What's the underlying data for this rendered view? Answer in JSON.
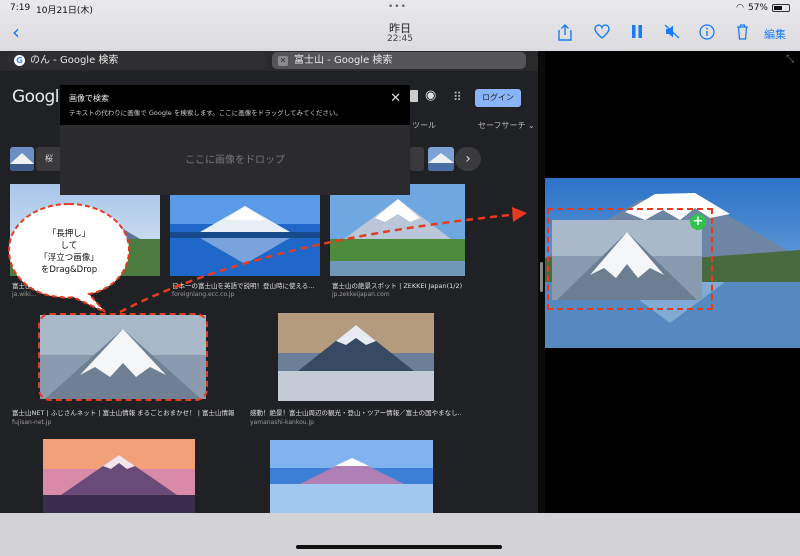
{
  "status": {
    "time": "7:19",
    "date": "10月21日(木)",
    "battery": "57%"
  },
  "toolbar": {
    "day": "昨日",
    "time": "22:45",
    "edit": "編集"
  },
  "browser": {
    "tabs": [
      {
        "label": "のん - Google 検索"
      },
      {
        "label": "富士山 - Google 検索"
      }
    ],
    "logo": "Google",
    "login": "ログイン",
    "tools": "ツール",
    "safe_search": "セーフサーチ ⌄",
    "chip_label": "桜"
  },
  "modal": {
    "title": "画像で検索",
    "subtitle": "テキストの代わりに画像で Google を検索します。ここに画像をドラッグしてみてください。",
    "drop": "ここに画像をドロップ"
  },
  "bubble": {
    "lines": [
      "「長押し」",
      "して",
      "「浮立つ画像」",
      "をDrag&Drop"
    ]
  },
  "results": [
    {
      "caption": "富士山...",
      "source": "ja.wiki..."
    },
    {
      "caption": "日本一の富士山を英語で説明！登山時に使える...",
      "source": "foreignlang.ecc.co.jp"
    },
    {
      "caption": "富士山の絶景スポット | ZEKKEI Japan(1/2)",
      "source": "jp.zekkeijapan.com"
    },
    {
      "caption": "富士山NET | ふじさんネット | 富士山情報 まるごとおまかせ！ | 富士山情報...",
      "source": "fujisan-net.jp"
    },
    {
      "caption": "感動！絶景！富士山周辺の観光・登山・ツアー情報／富士の国やまなし...",
      "source": "yamanashi-kankou.jp"
    }
  ],
  "colors": {
    "accent": "#1a7bf5",
    "annotation": "#e63b20",
    "plus": "#2fc44a"
  }
}
